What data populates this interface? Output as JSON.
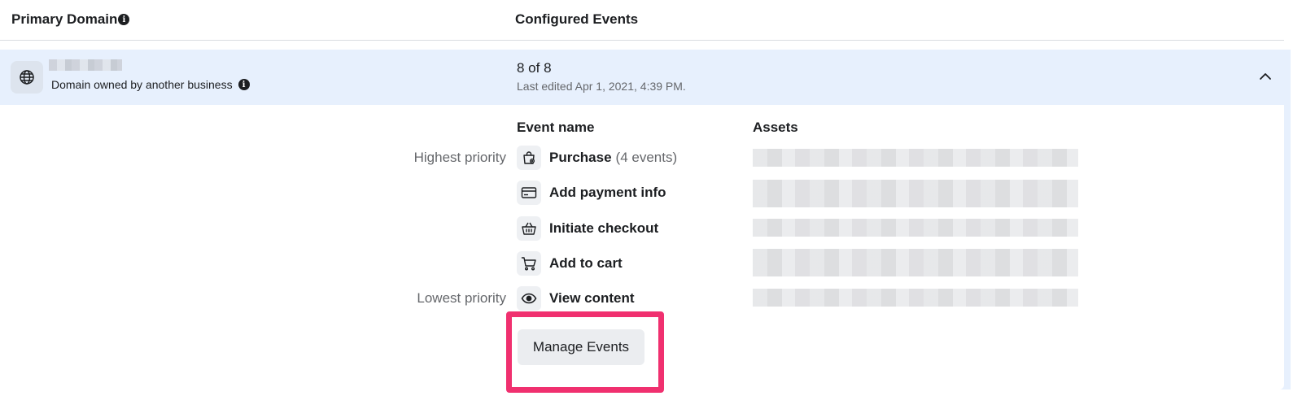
{
  "header": {
    "primary_domain_label": "Primary Domain",
    "configured_events_label": "Configured Events"
  },
  "domain_row": {
    "owner_text": "Domain owned by another business",
    "events_count": "8 of 8",
    "last_edited": "Last edited Apr 1, 2021, 4:39 PM."
  },
  "events_panel": {
    "event_name_header": "Event name",
    "assets_header": "Assets",
    "highest_priority_label": "Highest priority",
    "lowest_priority_label": "Lowest priority",
    "events": [
      {
        "name": "Purchase",
        "count": "(4 events)",
        "icon": "shopping-bag-icon"
      },
      {
        "name": "Add payment info",
        "count": "",
        "icon": "credit-card-icon"
      },
      {
        "name": "Initiate checkout",
        "count": "",
        "icon": "basket-icon"
      },
      {
        "name": "Add to cart",
        "count": "",
        "icon": "cart-icon"
      },
      {
        "name": "View content",
        "count": "",
        "icon": "eye-icon"
      }
    ],
    "manage_button_label": "Manage Events"
  },
  "colors": {
    "accent_highlight": "#f0306f",
    "row_background": "#e7f0fd"
  }
}
